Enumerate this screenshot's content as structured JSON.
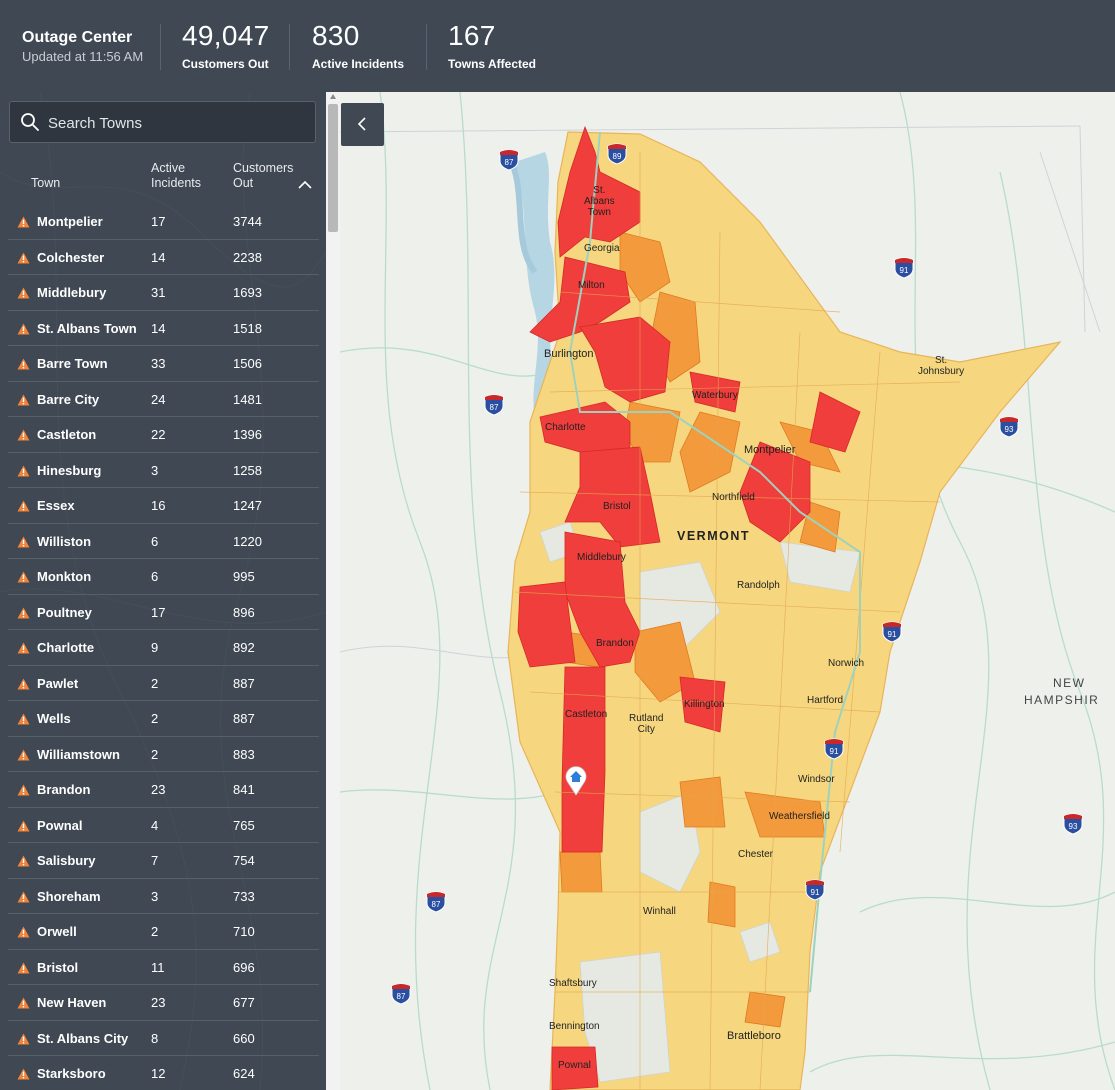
{
  "header": {
    "title": "Outage Center",
    "updated": "Updated at 11:56 AM",
    "stats": [
      {
        "value": "49,047",
        "label": "Customers Out"
      },
      {
        "value": "830",
        "label": "Active Incidents"
      },
      {
        "value": "167",
        "label": "Towns Affected"
      }
    ]
  },
  "search": {
    "placeholder": "Search Towns"
  },
  "table": {
    "col_town": "Town",
    "col_incidents": "Active\nIncidents",
    "col_customers": "Customers\nOut",
    "rows": [
      {
        "town": "Montpelier",
        "incidents": "17",
        "customers": "3744"
      },
      {
        "town": "Colchester",
        "incidents": "14",
        "customers": "2238"
      },
      {
        "town": "Middlebury",
        "incidents": "31",
        "customers": "1693"
      },
      {
        "town": "St. Albans Town",
        "incidents": "14",
        "customers": "1518"
      },
      {
        "town": "Barre Town",
        "incidents": "33",
        "customers": "1506"
      },
      {
        "town": "Barre City",
        "incidents": "24",
        "customers": "1481"
      },
      {
        "town": "Castleton",
        "incidents": "22",
        "customers": "1396"
      },
      {
        "town": "Hinesburg",
        "incidents": "3",
        "customers": "1258"
      },
      {
        "town": "Essex",
        "incidents": "16",
        "customers": "1247"
      },
      {
        "town": "Williston",
        "incidents": "6",
        "customers": "1220"
      },
      {
        "town": "Monkton",
        "incidents": "6",
        "customers": "995"
      },
      {
        "town": "Poultney",
        "incidents": "17",
        "customers": "896"
      },
      {
        "town": "Charlotte",
        "incidents": "9",
        "customers": "892"
      },
      {
        "town": "Pawlet",
        "incidents": "2",
        "customers": "887"
      },
      {
        "town": "Wells",
        "incidents": "2",
        "customers": "887"
      },
      {
        "town": "Williamstown",
        "incidents": "2",
        "customers": "883"
      },
      {
        "town": "Brandon",
        "incidents": "23",
        "customers": "841"
      },
      {
        "town": "Pownal",
        "incidents": "4",
        "customers": "765"
      },
      {
        "town": "Salisbury",
        "incidents": "7",
        "customers": "754"
      },
      {
        "town": "Shoreham",
        "incidents": "3",
        "customers": "733"
      },
      {
        "town": "Orwell",
        "incidents": "2",
        "customers": "710"
      },
      {
        "town": "Bristol",
        "incidents": "11",
        "customers": "696"
      },
      {
        "town": "New Haven",
        "incidents": "23",
        "customers": "677"
      },
      {
        "town": "St. Albans City",
        "incidents": "8",
        "customers": "660"
      },
      {
        "town": "Starksboro",
        "incidents": "12",
        "customers": "624"
      }
    ]
  },
  "map": {
    "state_label": "VERMONT",
    "neighbor_label_1": "NEW",
    "neighbor_label_2": "HAMPSHIR",
    "towns": {
      "st_albans_1": "St.",
      "st_albans_2": "Albans",
      "st_albans_3": "Town",
      "georgia": "Georgia",
      "milton": "Milton",
      "burlington": "Burlington",
      "waterbury": "Waterbury",
      "charlotte": "Charlotte",
      "montpelier": "Montpelier",
      "northfield": "Northfield",
      "bristol": "Bristol",
      "middlebury": "Middlebury",
      "randolph": "Randolph",
      "brandon": "Brandon",
      "norwich": "Norwich",
      "hartford": "Hartford",
      "killington": "Killington",
      "castleton": "Castleton",
      "rutland_1": "Rutland",
      "rutland_2": "City",
      "windsor": "Windsor",
      "weathersfield": "Weathersfield",
      "chester": "Chester",
      "winhall": "Winhall",
      "shaftsbury": "Shaftsbury",
      "bennington": "Bennington",
      "brattleboro": "Brattleboro",
      "pownal": "Pownal",
      "st_johnsbury_1": "St.",
      "st_johnsbury_2": "Johnsbury"
    },
    "shields": [
      "89",
      "87",
      "87",
      "87",
      "87",
      "91",
      "91",
      "91",
      "91",
      "91",
      "93",
      "93"
    ],
    "colors": {
      "high": "#ef3e3b",
      "mid": "#f39a3c",
      "low": "#f6d77f",
      "none": "#e6e9e2"
    }
  }
}
